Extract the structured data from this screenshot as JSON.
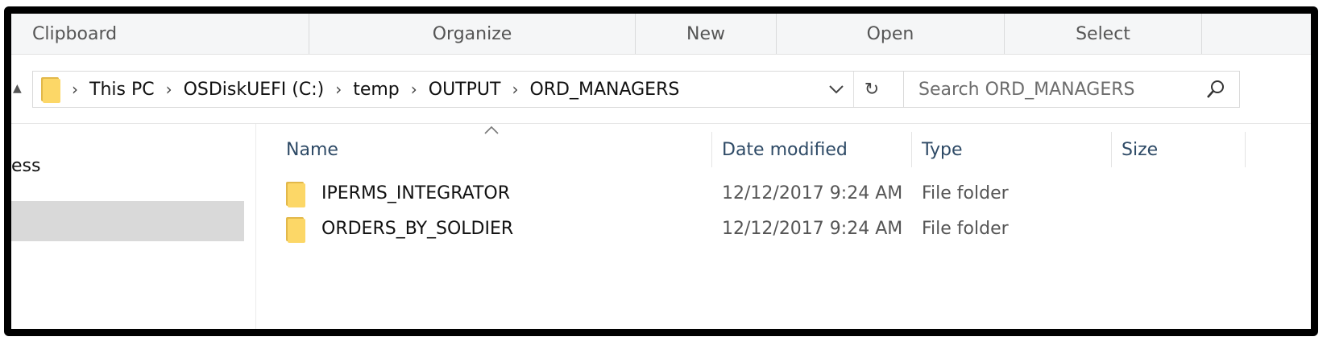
{
  "ribbon": {
    "groups": [
      "Clipboard",
      "Organize",
      "New",
      "Open",
      "Select"
    ]
  },
  "address": {
    "crumbs": [
      "This PC",
      "OSDiskUEFI (C:)",
      "temp",
      "OUTPUT",
      "ORD_MANAGERS"
    ]
  },
  "search": {
    "placeholder": "Search ORD_MANAGERS"
  },
  "navpane": {
    "partial_label": "ess"
  },
  "columns": {
    "name": "Name",
    "date": "Date modified",
    "type": "Type",
    "size": "Size"
  },
  "files": [
    {
      "name": "IPERMS_INTEGRATOR",
      "date": "12/12/2017 9:24 AM",
      "type": "File folder",
      "size": ""
    },
    {
      "name": "ORDERS_BY_SOLDIER",
      "date": "12/12/2017 9:24 AM",
      "type": "File folder",
      "size": ""
    }
  ],
  "icons": {
    "folder": "folder-icon",
    "search": "search-icon",
    "refresh": "refresh-icon",
    "dropdown": "chevron-down-icon"
  },
  "colors": {
    "folder_front": "#fcd767",
    "folder_back": "#e2b84a",
    "header_text": "#2e4a66",
    "selection": "#d9d9d9"
  }
}
